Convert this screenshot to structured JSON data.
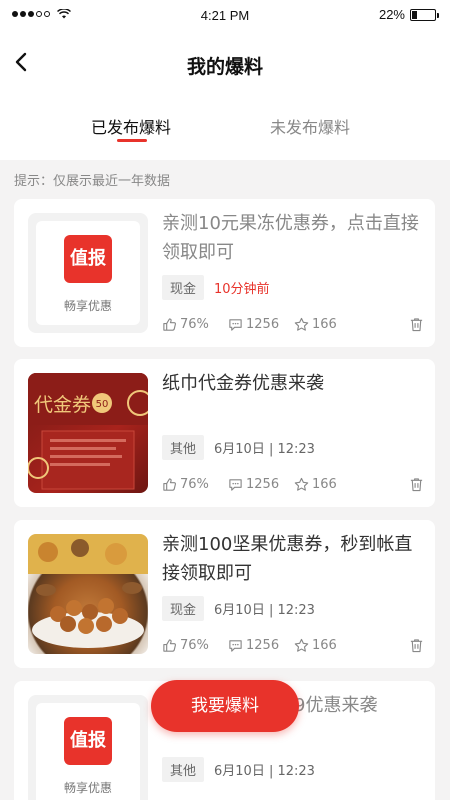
{
  "status_bar": {
    "time": "4:21 PM",
    "battery": "22%",
    "battery_level": 0.22
  },
  "header": {
    "title": "我的爆料"
  },
  "tabs": [
    {
      "label": "已发布爆料",
      "active": true
    },
    {
      "label": "未发布爆料",
      "active": false
    }
  ],
  "notice": "提示：仅展示最近一年数据",
  "cards": [
    {
      "thumb": "logo",
      "logo_text": "值报",
      "logo_sub": "畅享优惠",
      "title": "亲测10元果冻优惠券，点击直接领取即可",
      "title_faded": true,
      "tag": "现金",
      "time": "10分钟前",
      "time_highlight": true,
      "likes": "76%",
      "comments": "1256",
      "favorites": "166"
    },
    {
      "thumb": "coupon",
      "title": "纸巾代金券优惠来袭",
      "title_faded": false,
      "tag": "其他",
      "time": "6月10日 | 12:23",
      "time_highlight": false,
      "likes": "76%",
      "comments": "1256",
      "favorites": "166"
    },
    {
      "thumb": "nuts",
      "title": "亲测100坚果优惠券，秒到帐直接领取即可",
      "title_faded": false,
      "tag": "现金",
      "time": "6月10日 | 12:23",
      "time_highlight": false,
      "likes": "76%",
      "comments": "1256",
      "favorites": "166"
    },
    {
      "thumb": "logo",
      "logo_text": "值报",
      "logo_sub": "畅享优惠",
      "title_visible": "9优惠来袭",
      "title_faded": true,
      "tag": "其他",
      "time": "6月10日 | 12:23",
      "time_highlight": false
    }
  ],
  "coupon_image": {
    "text": "代金券",
    "value": "50"
  },
  "fab": {
    "label": "我要爆料"
  },
  "colors": {
    "accent": "#e8332b",
    "background": "#f4f3f3"
  },
  "icons": {
    "back": "chevron-left-icon",
    "like": "thumb-up-icon",
    "comment": "comment-icon",
    "favorite": "star-icon",
    "delete": "trash-icon"
  }
}
